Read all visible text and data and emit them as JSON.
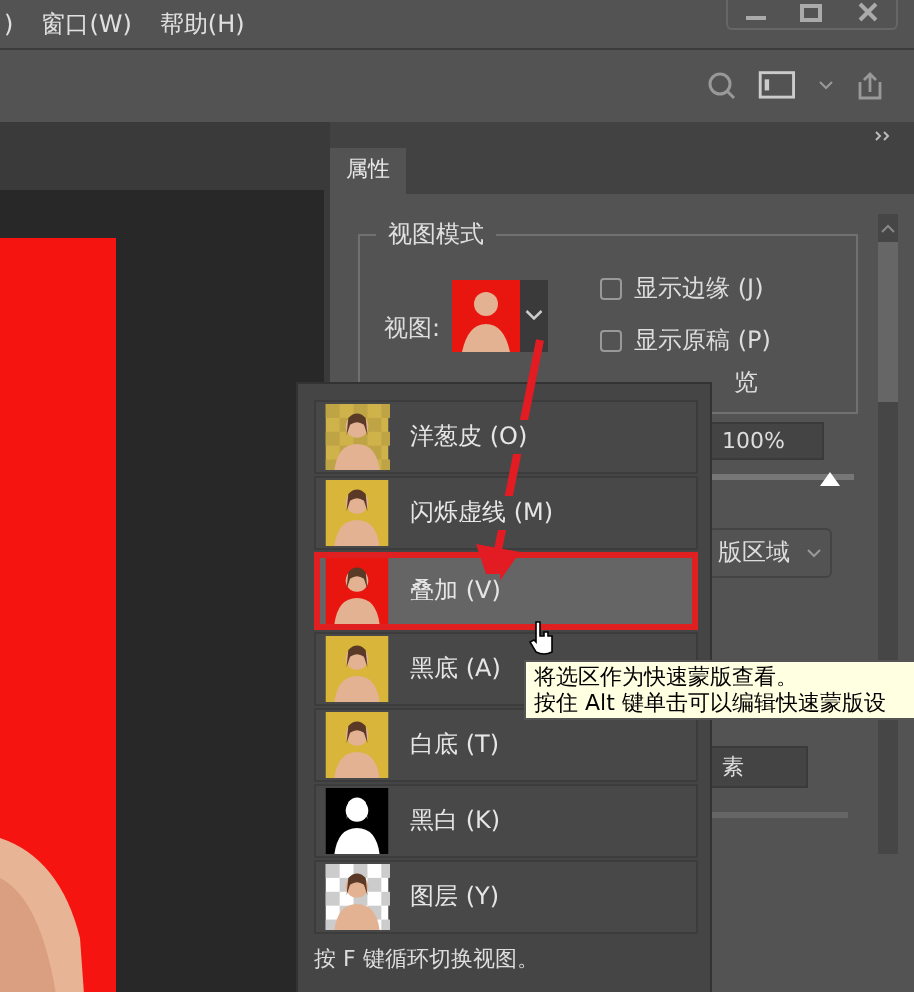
{
  "menu_bar": {
    "items": [
      ")",
      "窗口(W)",
      "帮助(H)"
    ]
  },
  "properties_panel": {
    "tab": "属性",
    "group_title": "视图模式",
    "view_label": "视图:",
    "view_thumbnail": {
      "kind": "red"
    },
    "checkboxes": [
      {
        "label": "显示边缘 (J)",
        "checked": false
      },
      {
        "label": "显示原稿 (P)",
        "checked": false
      }
    ],
    "preview_label": "览",
    "opacity_field": "100%",
    "opacity_slider": {
      "level": 0.92
    },
    "mask_select": "版区域",
    "pixel_field": "素"
  },
  "view_menu": {
    "items": [
      {
        "label": "洋葱皮 (O)",
        "kind": "onion",
        "selected": false
      },
      {
        "label": "闪烁虚线 (M)",
        "kind": "yellow",
        "selected": false
      },
      {
        "label": "叠加 (V)",
        "kind": "red",
        "selected": true
      },
      {
        "label": "黑底 (A)",
        "kind": "yellow",
        "selected": false
      },
      {
        "label": "白底 (T)",
        "kind": "yellow",
        "selected": false
      },
      {
        "label": "黑白 (K)",
        "kind": "black",
        "selected": false
      },
      {
        "label": "图层 (Y)",
        "kind": "checker",
        "selected": false
      }
    ],
    "hint": "按 F 键循环切换视图。"
  },
  "tooltip": {
    "lines": [
      "将选区作为快速蒙版查看。",
      "按住 Alt 键单击可以编辑快速蒙版设"
    ]
  }
}
